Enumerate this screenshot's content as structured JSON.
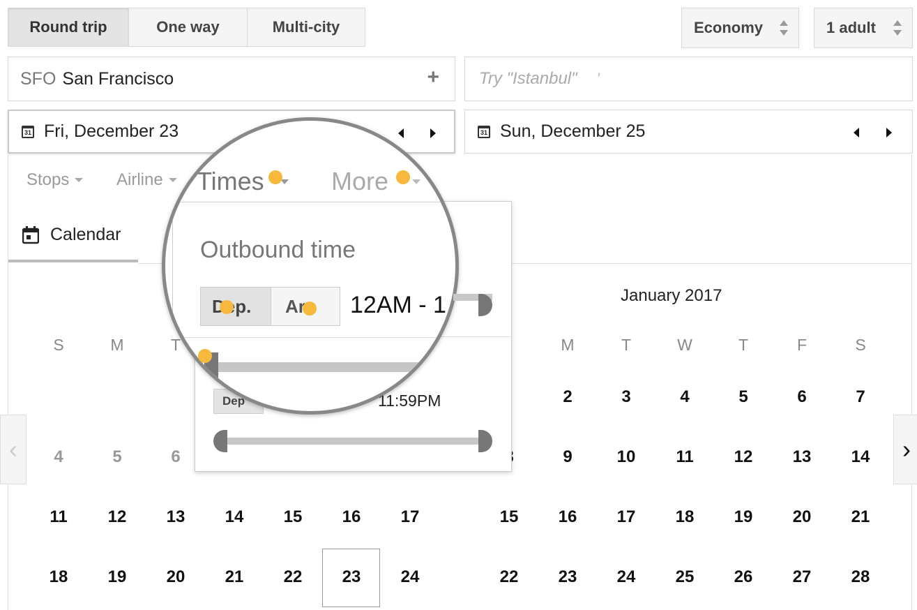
{
  "trip_tabs": [
    "Round trip",
    "One way",
    "Multi-city"
  ],
  "cabin": "Economy",
  "passengers": "1 adult",
  "origin": {
    "code": "SFO",
    "city": "San Francisco",
    "add": "+"
  },
  "destination": {
    "placeholder": "Try \"Istanbul\"",
    "cursor": "'"
  },
  "depart_date": "Fri, December 23",
  "return_date": "Sun, December 25",
  "calendar_icon_text": "31",
  "filters": {
    "stops": "Stops",
    "airline": "Airline",
    "times": "Times",
    "more": "More"
  },
  "calendar_tab": "Calendar",
  "times_panel": {
    "title": "Outbound time",
    "dep": "Dep.",
    "arr": "Arr.",
    "range": "12AM - 1",
    "return_dep": "Dep",
    "return_end": "11:59PM"
  },
  "month_right": "January 2017",
  "weekdays": [
    "S",
    "M",
    "T",
    "W",
    "T",
    "F",
    "S"
  ],
  "left_rows": [
    [],
    [
      "4",
      "5",
      "6"
    ],
    [
      "11",
      "12",
      "13",
      "14",
      "15",
      "16",
      "17"
    ],
    [
      "18",
      "19",
      "20",
      "21",
      "22",
      "23",
      "24"
    ]
  ],
  "right_rows": [
    [
      "2",
      "3",
      "4",
      "5",
      "6",
      "7"
    ],
    [
      "9",
      "10",
      "11",
      "12",
      "13",
      "14"
    ],
    [
      "15",
      "16",
      "17",
      "18",
      "19",
      "20",
      "21"
    ],
    [
      "22",
      "23",
      "24",
      "25",
      "26",
      "27",
      "28"
    ]
  ],
  "right_row2_partial": "8",
  "nav": {
    "prev": "‹",
    "next": "›"
  },
  "colors": {
    "highlight_dot": "#f6b93b"
  }
}
